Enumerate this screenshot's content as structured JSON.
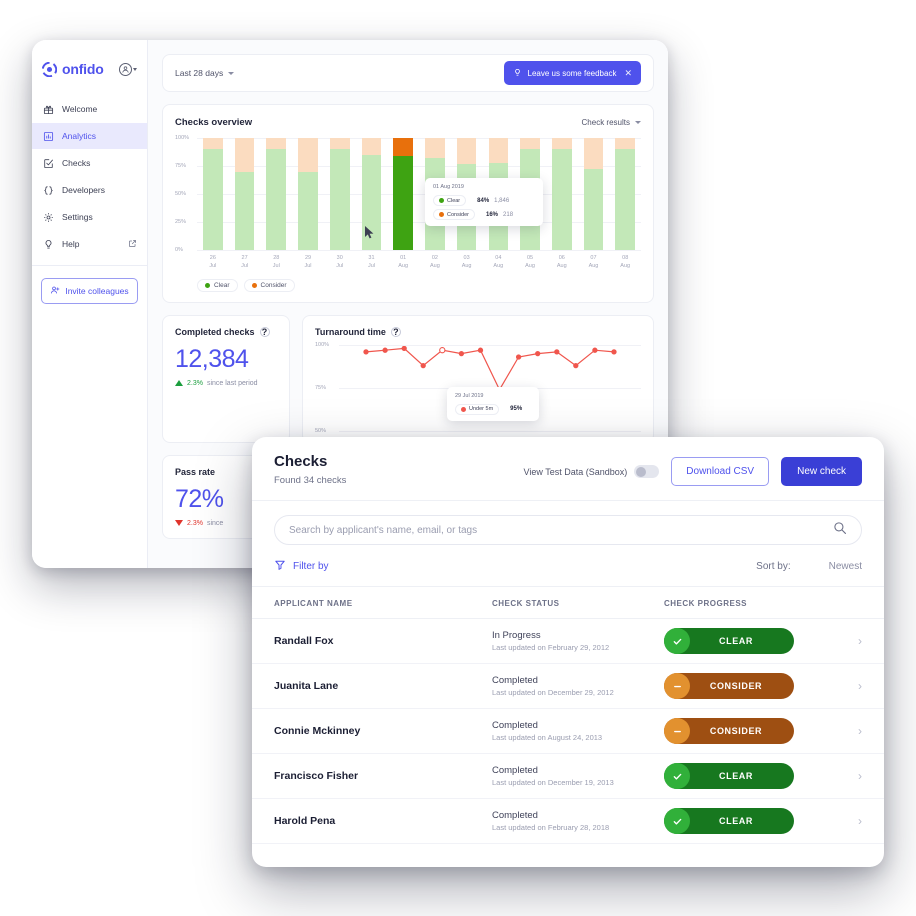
{
  "brand": {
    "name": "onfido"
  },
  "sidebar": {
    "items": [
      {
        "label": "Welcome",
        "icon": "gift-icon",
        "active": false
      },
      {
        "label": "Analytics",
        "icon": "bar-chart-icon",
        "active": true
      },
      {
        "label": "Checks",
        "icon": "checklist-icon",
        "active": false
      },
      {
        "label": "Developers",
        "icon": "braces-icon",
        "active": false
      },
      {
        "label": "Settings",
        "icon": "gear-icon",
        "active": false
      },
      {
        "label": "Help",
        "icon": "lightbulb-icon",
        "active": false,
        "external": true
      }
    ],
    "invite_label": "Invite colleagues"
  },
  "topbar": {
    "range_label": "Last 28 days",
    "feedback_label": "Leave us some feedback",
    "close_label": "✕"
  },
  "checks_overview": {
    "title": "Checks overview",
    "dropdown_label": "Check results",
    "legend": [
      {
        "label": "Clear",
        "color": "#3ea312"
      },
      {
        "label": "Consider",
        "color": "#e8700c"
      }
    ],
    "tooltip": {
      "date": "01 Aug 2019",
      "rows": [
        {
          "label": "Clear",
          "percent": "84%",
          "count": "1,846",
          "color": "#3ea312"
        },
        {
          "label": "Consider",
          "percent": "16%",
          "count": "218",
          "color": "#e8700c"
        }
      ]
    }
  },
  "chart_data": [
    {
      "type": "bar",
      "title": "Checks overview",
      "stacked": true,
      "xlabel": "",
      "ylabel": "",
      "ylim": [
        0,
        100
      ],
      "yticks": [
        "0%",
        "25%",
        "50%",
        "75%",
        "100%"
      ],
      "grid": true,
      "legend_position": "bottom-left",
      "categories": [
        "26 Jul",
        "27 Jul",
        "28 Jul",
        "29 Jul",
        "30 Jul",
        "31 Jul",
        "01 Aug",
        "02 Aug",
        "03 Aug",
        "04 Aug",
        "05 Aug",
        "06 Aug",
        "07 Aug",
        "08 Aug"
      ],
      "highlight_index": 6,
      "series": [
        {
          "name": "Clear",
          "color": "#c3e8b8",
          "highlight_color": "#3ea312",
          "values": [
            90,
            70,
            90,
            70,
            90,
            85,
            84,
            82,
            77,
            78,
            90,
            90,
            72,
            90
          ]
        },
        {
          "name": "Consider",
          "color": "#fbdcc0",
          "highlight_color": "#e8700c",
          "values": [
            10,
            30,
            10,
            30,
            10,
            15,
            16,
            18,
            23,
            22,
            10,
            10,
            28,
            10
          ]
        }
      ]
    },
    {
      "type": "line",
      "title": "Turnaround time",
      "ylim": [
        50,
        100
      ],
      "yticks": [
        "50%",
        "75%",
        "100%"
      ],
      "grid": true,
      "series": [
        {
          "name": "Under 5m",
          "color": "#f0564d",
          "values": [
            96,
            97,
            98,
            88,
            97,
            95,
            97,
            74,
            93,
            95,
            96,
            88,
            97,
            96
          ]
        }
      ],
      "tooltip": {
        "date": "29 Jul 2019",
        "label": "Under 5m",
        "value": "95%",
        "color": "#f0564d"
      }
    }
  ],
  "stats": [
    {
      "title": "Completed checks",
      "value": "12,384",
      "delta": "2.3%",
      "delta_suffix": "since last period",
      "direction": "up"
    },
    {
      "title": "Pass rate",
      "value": "72%",
      "delta": "2.3%",
      "delta_suffix": "since",
      "direction": "down"
    }
  ],
  "turnaround": {
    "title": "Turnaround time"
  },
  "checks_panel": {
    "title": "Checks",
    "subtitle": "Found 34 checks",
    "sandbox_label": "View Test Data (Sandbox)",
    "download_label": "Download CSV",
    "new_check_label": "New check",
    "search_placeholder": "Search by applicant's name, email, or tags",
    "filter_label": "Filter by",
    "sort_label": "Sort by:",
    "sort_value": "Newest",
    "columns": [
      "APPLICANT NAME",
      "CHECK STATUS",
      "CHECK PROGRESS"
    ],
    "rows": [
      {
        "name": "Randall Fox",
        "status": "In Progress",
        "updated": "Last updated on February 29, 2012",
        "progress": "CLEAR",
        "progress_kind": "clear"
      },
      {
        "name": "Juanita Lane",
        "status": "Completed",
        "updated": "Last updated on December 29, 2012",
        "progress": "CONSIDER",
        "progress_kind": "consider"
      },
      {
        "name": "Connie Mckinney",
        "status": "Completed",
        "updated": "Last updated on August 24, 2013",
        "progress": "CONSIDER",
        "progress_kind": "consider"
      },
      {
        "name": "Francisco Fisher",
        "status": "Completed",
        "updated": "Last updated on December 19, 2013",
        "progress": "CLEAR",
        "progress_kind": "clear"
      },
      {
        "name": "Harold Pena",
        "status": "Completed",
        "updated": "Last updated on February 28, 2018",
        "progress": "CLEAR",
        "progress_kind": "clear"
      }
    ]
  },
  "colors": {
    "accent": "#4f52ec",
    "accent_solid": "#3a3fd6",
    "clear": "#17781f",
    "clear_light": "#31b03a",
    "consider": "#9e4f12",
    "consider_light": "#e2912f",
    "up": "#1b9e3e",
    "down": "#e0342c"
  }
}
